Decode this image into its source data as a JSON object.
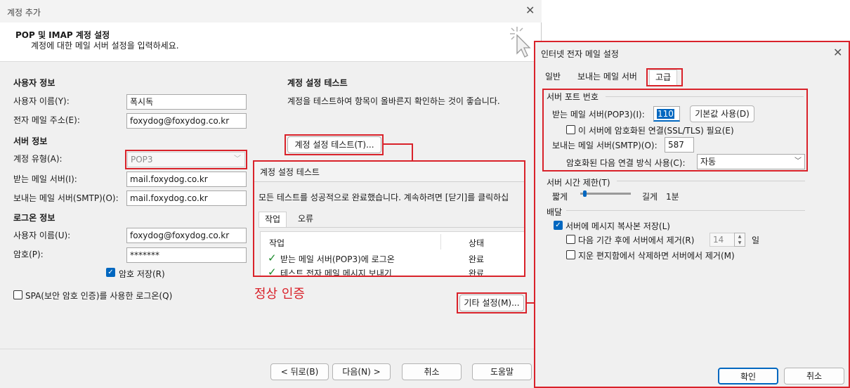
{
  "main_dialog": {
    "title": "계정 추가",
    "header": {
      "title": "POP 및 IMAP 계정 설정",
      "subtitle": "계정에 대한 메일 서버 설정을 입력하세요."
    },
    "user_info": {
      "section": "사용자 정보",
      "name_label": "사용자 이름(Y):",
      "name_value": "폭시독",
      "email_label": "전자 메일 주소(E):",
      "email_value": "foxydog@foxydog.co.kr"
    },
    "server_info": {
      "section": "서버 정보",
      "type_label": "계정 유형(A):",
      "type_value": "POP3",
      "incoming_label": "받는 메일 서버(I):",
      "incoming_value": "mail.foxydog.co.kr",
      "outgoing_label": "보내는 메일 서버(SMTP)(O):",
      "outgoing_value": "mail.foxydog.co.kr"
    },
    "login_info": {
      "section": "로그온 정보",
      "user_label": "사용자 이름(U):",
      "user_value": "foxydog@foxydog.co.kr",
      "password_label": "암호(P):",
      "password_value": "*******",
      "save_password_label": "암호 저장(R)",
      "spa_label": "SPA(보안 암호 인증)를 사용한 로그온(Q)"
    },
    "test_settings": {
      "section": "계정 설정 테스트",
      "description": "계정을 테스트하여 항목이 올바른지 확인하는 것이 좋습니다.",
      "test_button": "계정 설정 테스트(T)..."
    },
    "more_settings_button": "기타 설정(M)...",
    "annotation": "정상 인증",
    "buttons": {
      "back": "< 뒤로(B)",
      "next": "다음(N) >",
      "cancel": "취소",
      "help": "도움말"
    }
  },
  "test_panel": {
    "title": "계정 설정 테스트",
    "message": "모든 테스트를 성공적으로 완료했습니다. 계속하려면 [닫기]를 클릭하십",
    "tabs": [
      "작업",
      "오류"
    ],
    "columns": [
      "작업",
      "상태"
    ],
    "rows": [
      {
        "task": "받는 메일 서버(POP3)에 로그온",
        "status": "완료"
      },
      {
        "task": "테스트 전자 메일 메시지 보내기",
        "status": "완료"
      }
    ]
  },
  "internet_dialog": {
    "title": "인터넷 전자 메일 설정",
    "tabs": [
      "일반",
      "보내는 메일 서버",
      "고급"
    ],
    "ports": {
      "section": "서버 포트 번호",
      "incoming_label": "받는 메일 서버(POP3)(I):",
      "incoming_value": "110",
      "default_button": "기본값 사용(D)",
      "ssl_label": "이 서버에 암호화된 연결(SSL/TLS) 필요(E)",
      "outgoing_label": "보내는 메일 서버(SMTP)(O):",
      "outgoing_value": "587",
      "encryption_label": "암호화된 다음 연결 방식 사용(C):",
      "encryption_value": "자동"
    },
    "timeout": {
      "section": "서버 시간 제한(T)",
      "short": "짧게",
      "long": "길게",
      "value": "1분"
    },
    "delivery": {
      "section": "배달",
      "leave_copy_label": "서버에 메시지 복사본 저장(L)",
      "remove_after_label": "다음 기간 후에 서버에서 제거(R)",
      "days_value": "14",
      "days_unit": "일",
      "remove_deleted_label": "지운 편지함에서 삭제하면 서버에서 제거(M)"
    },
    "buttons": {
      "ok": "확인",
      "cancel": "취소"
    }
  }
}
